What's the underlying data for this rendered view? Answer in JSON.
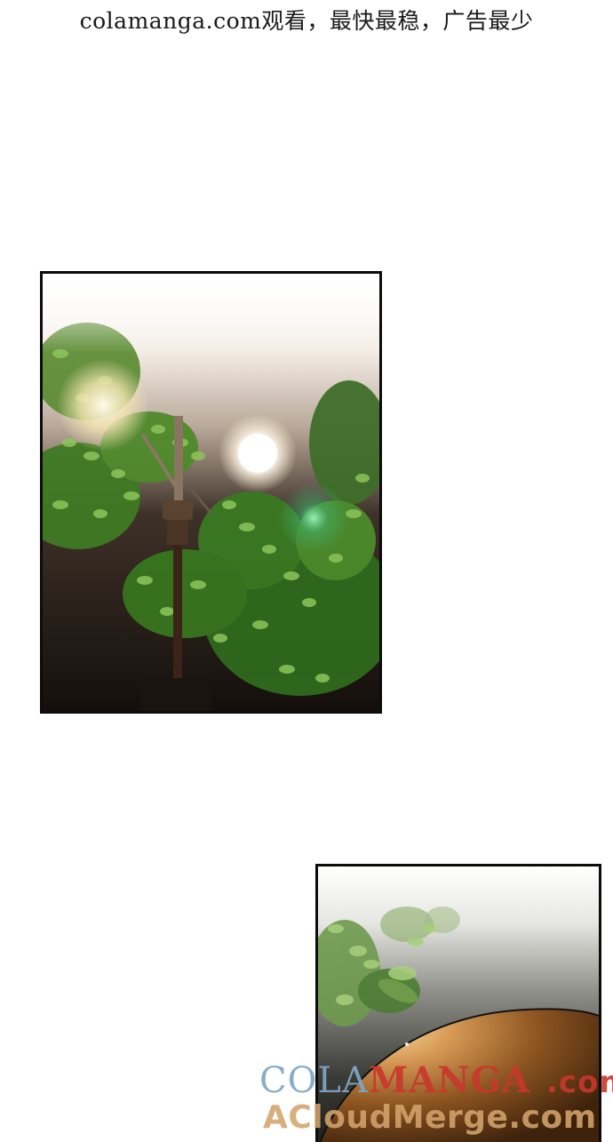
{
  "header": {
    "text": "colamanga.com观看，最快最稳，广告最少"
  },
  "panels": [
    {
      "id": "panel-1",
      "scene": "street-lamp-night"
    },
    {
      "id": "panel-2",
      "scene": "leaves-and-orange-orb"
    }
  ],
  "watermark": {
    "part_cola": "COLA",
    "part_manga": "MANGA",
    "part_com": ".com",
    "line2": "ACloudMerge.com"
  },
  "colors": {
    "background": "#ffffff",
    "panel_border": "#0c0c0c",
    "watermark_blue": "#7fa6c6",
    "watermark_red": "#c9372c",
    "watermark_tan": "#d3a46c"
  }
}
